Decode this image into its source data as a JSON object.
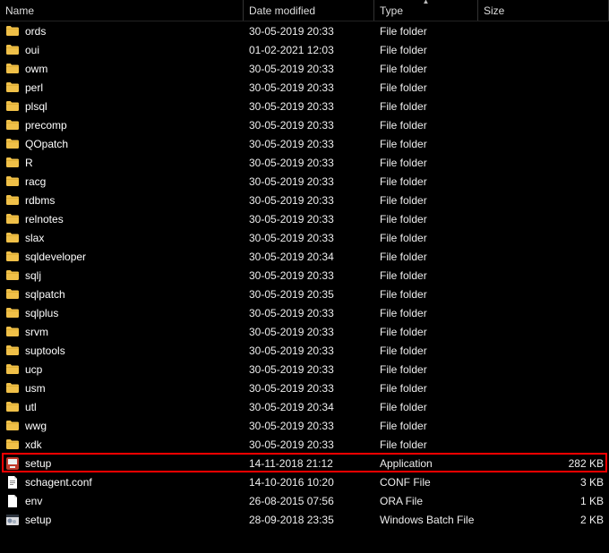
{
  "columns": {
    "name": "Name",
    "date": "Date modified",
    "type": "Type",
    "size": "Size"
  },
  "rows": [
    {
      "icon": "folder",
      "name": "ords",
      "date": "30-05-2019 20:33",
      "type": "File folder",
      "size": ""
    },
    {
      "icon": "folder",
      "name": "oui",
      "date": "01-02-2021 12:03",
      "type": "File folder",
      "size": ""
    },
    {
      "icon": "folder",
      "name": "owm",
      "date": "30-05-2019 20:33",
      "type": "File folder",
      "size": ""
    },
    {
      "icon": "folder",
      "name": "perl",
      "date": "30-05-2019 20:33",
      "type": "File folder",
      "size": ""
    },
    {
      "icon": "folder",
      "name": "plsql",
      "date": "30-05-2019 20:33",
      "type": "File folder",
      "size": ""
    },
    {
      "icon": "folder",
      "name": "precomp",
      "date": "30-05-2019 20:33",
      "type": "File folder",
      "size": ""
    },
    {
      "icon": "folder",
      "name": "QOpatch",
      "date": "30-05-2019 20:33",
      "type": "File folder",
      "size": ""
    },
    {
      "icon": "folder",
      "name": "R",
      "date": "30-05-2019 20:33",
      "type": "File folder",
      "size": ""
    },
    {
      "icon": "folder",
      "name": "racg",
      "date": "30-05-2019 20:33",
      "type": "File folder",
      "size": ""
    },
    {
      "icon": "folder",
      "name": "rdbms",
      "date": "30-05-2019 20:33",
      "type": "File folder",
      "size": ""
    },
    {
      "icon": "folder",
      "name": "relnotes",
      "date": "30-05-2019 20:33",
      "type": "File folder",
      "size": ""
    },
    {
      "icon": "folder",
      "name": "slax",
      "date": "30-05-2019 20:33",
      "type": "File folder",
      "size": ""
    },
    {
      "icon": "folder",
      "name": "sqldeveloper",
      "date": "30-05-2019 20:34",
      "type": "File folder",
      "size": ""
    },
    {
      "icon": "folder",
      "name": "sqlj",
      "date": "30-05-2019 20:33",
      "type": "File folder",
      "size": ""
    },
    {
      "icon": "folder",
      "name": "sqlpatch",
      "date": "30-05-2019 20:35",
      "type": "File folder",
      "size": ""
    },
    {
      "icon": "folder",
      "name": "sqlplus",
      "date": "30-05-2019 20:33",
      "type": "File folder",
      "size": ""
    },
    {
      "icon": "folder",
      "name": "srvm",
      "date": "30-05-2019 20:33",
      "type": "File folder",
      "size": ""
    },
    {
      "icon": "folder",
      "name": "suptools",
      "date": "30-05-2019 20:33",
      "type": "File folder",
      "size": ""
    },
    {
      "icon": "folder",
      "name": "ucp",
      "date": "30-05-2019 20:33",
      "type": "File folder",
      "size": ""
    },
    {
      "icon": "folder",
      "name": "usm",
      "date": "30-05-2019 20:33",
      "type": "File folder",
      "size": ""
    },
    {
      "icon": "folder",
      "name": "utl",
      "date": "30-05-2019 20:34",
      "type": "File folder",
      "size": ""
    },
    {
      "icon": "folder",
      "name": "wwg",
      "date": "30-05-2019 20:33",
      "type": "File folder",
      "size": ""
    },
    {
      "icon": "folder",
      "name": "xdk",
      "date": "30-05-2019 20:33",
      "type": "File folder",
      "size": ""
    },
    {
      "icon": "installer",
      "name": "setup",
      "date": "14-11-2018 21:12",
      "type": "Application",
      "size": "282 KB",
      "highlight": true
    },
    {
      "icon": "conf",
      "name": "schagent.conf",
      "date": "14-10-2016 10:20",
      "type": "CONF File",
      "size": "3 KB"
    },
    {
      "icon": "ora",
      "name": "env",
      "date": "26-08-2015 07:56",
      "type": "ORA File",
      "size": "1 KB"
    },
    {
      "icon": "batch",
      "name": "setup",
      "date": "28-09-2018 23:35",
      "type": "Windows Batch File",
      "size": "2 KB"
    }
  ]
}
